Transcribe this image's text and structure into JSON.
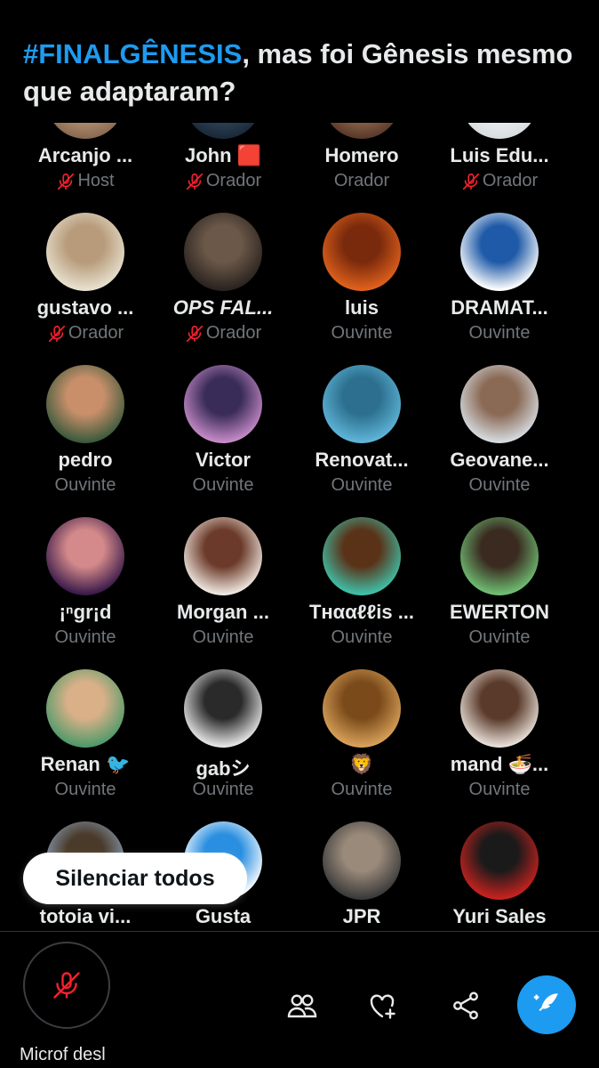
{
  "space": {
    "title_hashtag": "#FINALGÊNESIS",
    "title_rest": ", mas foi Gênesis mesmo que adaptaram?"
  },
  "participants": [
    {
      "name": "Arcanjo ...",
      "role": "Host",
      "muted": true,
      "avatar_colors": [
        "#8a6b52",
        "#c9a27f"
      ]
    },
    {
      "name": "John 🟥",
      "role": "Orador",
      "muted": true,
      "avatar_colors": [
        "#1a2a3a",
        "#3b4f66"
      ]
    },
    {
      "name": "Homero",
      "role": "Orador",
      "muted": false,
      "avatar_colors": [
        "#5a3a2a",
        "#a87b5c"
      ]
    },
    {
      "name": "Luis Edu...",
      "role": "Orador",
      "muted": true,
      "avatar_colors": [
        "#d8dde0",
        "#f4f6f7"
      ]
    },
    {
      "name": "gustavo ...",
      "role": "Orador",
      "muted": true,
      "avatar_colors": [
        "#e8e1cf",
        "#b79b7a"
      ]
    },
    {
      "name": "OPS FAL...",
      "role": "Orador",
      "muted": true,
      "avatar_colors": [
        "#2a2320",
        "#6b5848"
      ]
    },
    {
      "name": "luis",
      "role": "Ouvinte",
      "muted": false,
      "avatar_colors": [
        "#e0611c",
        "#7a2a0c"
      ]
    },
    {
      "name": "DRAMAT...",
      "role": "Ouvinte",
      "muted": false,
      "avatar_colors": [
        "#ffffff",
        "#1f5aa8"
      ]
    },
    {
      "name": "pedro",
      "role": "Ouvinte",
      "muted": false,
      "avatar_colors": [
        "#3c5a3c",
        "#c98f6a"
      ]
    },
    {
      "name": "Victor",
      "role": "Ouvinte",
      "muted": false,
      "avatar_colors": [
        "#c68bc8",
        "#3a2c58"
      ]
    },
    {
      "name": "Renovat...",
      "role": "Ouvinte",
      "muted": false,
      "avatar_colors": [
        "#5fb5d8",
        "#2c6f8e"
      ]
    },
    {
      "name": "Geovane...",
      "role": "Ouvinte",
      "muted": false,
      "avatar_colors": [
        "#d6dbe0",
        "#8a6a55"
      ]
    },
    {
      "name": "¡ⁿgr¡d",
      "role": "Ouvinte",
      "muted": false,
      "avatar_colors": [
        "#3a1a4a",
        "#d48a8a"
      ]
    },
    {
      "name": "Morgan ...",
      "role": "Ouvinte",
      "muted": false,
      "avatar_colors": [
        "#f0e8e0",
        "#6b3a2a"
      ]
    },
    {
      "name": "Tʜααℓℓis ...",
      "role": "Ouvinte",
      "muted": false,
      "avatar_colors": [
        "#3fc1a8",
        "#5a3218"
      ]
    },
    {
      "name": "EWERTON",
      "role": "Ouvinte",
      "muted": false,
      "avatar_colors": [
        "#6fbf73",
        "#3a2a20"
      ]
    },
    {
      "name": "Renan 🐦",
      "role": "Ouvinte",
      "muted": false,
      "avatar_colors": [
        "#4f9a6a",
        "#d9b088"
      ]
    },
    {
      "name": "gabシ",
      "role": "Ouvinte",
      "muted": false,
      "avatar_colors": [
        "#e6e6e6",
        "#2a2a2a"
      ]
    },
    {
      "name": "🦁",
      "role": "Ouvinte",
      "muted": false,
      "avatar_colors": [
        "#d9a25a",
        "#7a4a1a"
      ]
    },
    {
      "name": "mand 🍜...",
      "role": "Ouvinte",
      "muted": false,
      "avatar_colors": [
        "#e8e0d8",
        "#5a3a2a"
      ]
    },
    {
      "name": "totoia vi...",
      "role": "",
      "muted": false,
      "avatar_colors": [
        "#8aa0b8",
        "#4a3a2a"
      ]
    },
    {
      "name": "Gusta",
      "role": "",
      "muted": false,
      "avatar_colors": [
        "#ffffff",
        "#2a8fe0"
      ]
    },
    {
      "name": "JPR",
      "role": "",
      "muted": false,
      "avatar_colors": [
        "#3a3a3a",
        "#9a8a7a"
      ]
    },
    {
      "name": "Yuri Sales",
      "role": "",
      "muted": false,
      "avatar_colors": [
        "#c8221e",
        "#1a1a1a"
      ]
    }
  ],
  "toast": {
    "label": "Silenciar todos"
  },
  "bottom_bar": {
    "mic_label": "Microf desl",
    "icons": [
      "people-icon",
      "heart-plus-icon",
      "share-icon",
      "compose-icon"
    ]
  },
  "colors": {
    "accent": "#1d9bf0",
    "muted_red": "#f4212e",
    "secondary_text": "#71767b"
  }
}
